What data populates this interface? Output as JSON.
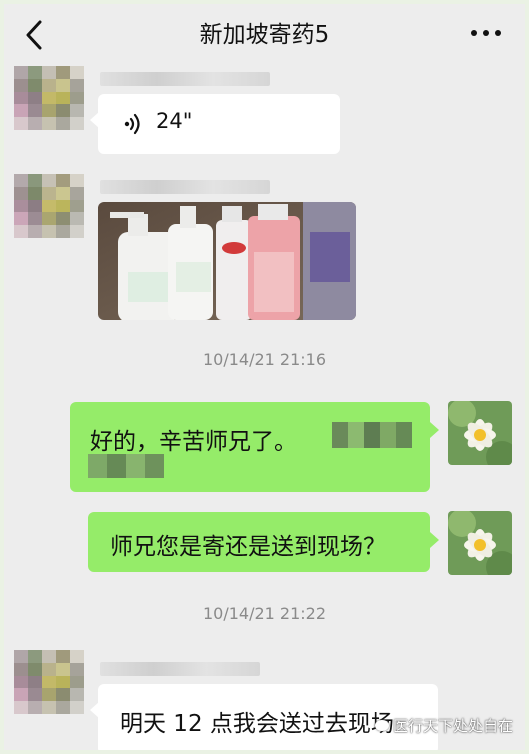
{
  "header": {
    "title": "新加坡寄药5"
  },
  "messages": {
    "voice": {
      "duration": "24\""
    },
    "time1": "10/14/21 21:16",
    "reply1": "好的，辛苦师兄了。",
    "reply2": "师兄您是寄还是送到现场？",
    "time2": "10/14/21 21:22",
    "incoming3": "明天 12 点我会送过去现场"
  },
  "watermark": "医行天下处处自在",
  "colors": {
    "bubble_green": "#95ec69",
    "bubble_white": "#ffffff",
    "background": "#ededed"
  }
}
